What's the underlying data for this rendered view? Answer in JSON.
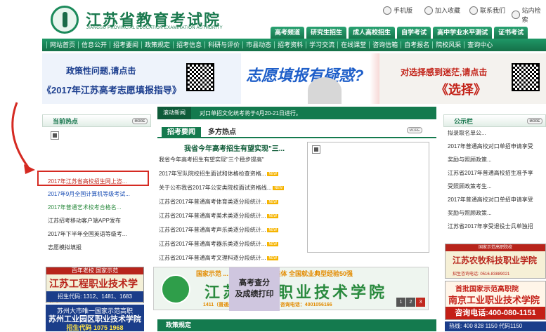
{
  "header": {
    "title": "江苏省教育考试院",
    "subtitle": "JIANGSU PROVINCIAL EDUCATION EXAMINATION AUTHORITY",
    "top_links": [
      "手机版",
      "加入收藏",
      "联系我们",
      "站内检索"
    ]
  },
  "tabs": [
    "高考频道",
    "研究生招生",
    "成人高校招生",
    "自学考试",
    "高中学业水平测试",
    "证书考试"
  ],
  "nav": [
    "网站首页",
    "信息公开",
    "招考要闻",
    "政策规定",
    "招考信息",
    "科研与评价",
    "市县动态",
    "招考资料",
    "学习交流",
    "在线课堂",
    "咨询信箱",
    "自考报名",
    "院校风采",
    "查询中心"
  ],
  "banner": {
    "left_line1": "政策性问题,请点击",
    "left_line2": "《2017年江苏高考志愿填报指导》",
    "center": "志愿填报有疑惑?",
    "right_line1": "对选择感到迷茫,请点击",
    "right_line2": "《选择》"
  },
  "left_panel": {
    "title": "当前热点",
    "more": "MORE",
    "items": [
      {
        "text": "2017年江苏省高校招生网上咨...",
        "color": "#c0291f"
      },
      {
        "text": "2017年9月全国计算机等级考试...",
        "color": "#1b4fb5"
      },
      {
        "text": "2017年普通艺术校考合格名...",
        "color": "#2a8a3e"
      },
      {
        "text": "江苏招考移动客户端APP发布",
        "color": "#333333"
      },
      {
        "text": "2017年下半年全国英语等级考...",
        "color": "#333333"
      },
      {
        "text": "志愿模拟填报",
        "color": "#333333"
      }
    ]
  },
  "left_ads": {
    "ad1_top": "百年老校 国家示范",
    "ad1_name": "江苏工程职业技术学院",
    "ad1_tel": "招生代码: 1312、1481、1683",
    "ad2_line1": "苏州大市唯一国家示范高职",
    "ad2_line2": "苏州工业园区职业技术学院",
    "ad2_code": "招生代码 1075 1968"
  },
  "center": {
    "scroll_label": "滚动新闻",
    "scroll_msg": "对口单招文化统考将于4月20-21日进行。",
    "tab1": "招考要闻",
    "tab2": "多方热点",
    "more": "MORE",
    "headline": "我省今年高考招生有望实现\"三...",
    "subline": "我省今年高考招生有望实现\"三个稳步提高\"",
    "new_tag": "NEW",
    "news": [
      "2017年军队院校招生面试和体格检查资格...",
      "关于公布我省2017年公安类院校面试资格线...",
      "江苏省2017年普通高考体育类逐分段统计...",
      "江苏省2017年普通高考美术类逐分段统计...",
      "江苏省2017年普通高考声乐类逐分段统计...",
      "江苏省2017年普通高考器乐类逐分段统计...",
      "江苏省2017年普通高考文理科逐分段统计..."
    ],
    "ad_title": "国家示范 ... 毕业生就业先进集体 全国就业典型经验50强",
    "ad_school": "江苏农林职业技术学院",
    "ad_tel": "1411（普通类） 1548（定制村官）咨询电话：4001056166",
    "query_line1": "高考查分",
    "query_line2": "及成绩打印",
    "pages": [
      "1",
      "2",
      "3"
    ],
    "policy": "政策规定"
  },
  "right_panel": {
    "title": "公示栏",
    "more": "MORE",
    "items": [
      "拟录取名单公...",
      "2017年普通高校对口单招申请享受",
      "奖励与照顾政策...",
      "江苏省2017年普通高校招生准予享",
      "受照顾政策考生...",
      "2017年普通高校对口单招申请享受",
      "奖励与照顾政策...",
      "江苏省2017年享受退役士兵单独招"
    ]
  },
  "right_ads": {
    "ad1_top": "国家示范高职院校",
    "ad1_name": "江苏农牧科技职业学院",
    "ad1_phone": "招生咨询电话: 0516-83889021",
    "ad2_a": "首批国家示范高职院",
    "ad2_b": "南京工业职业技术学院",
    "ad2_c": "咨询电话:400-080-1151",
    "ad3": "热线: 400 828 1150   代码1150"
  }
}
